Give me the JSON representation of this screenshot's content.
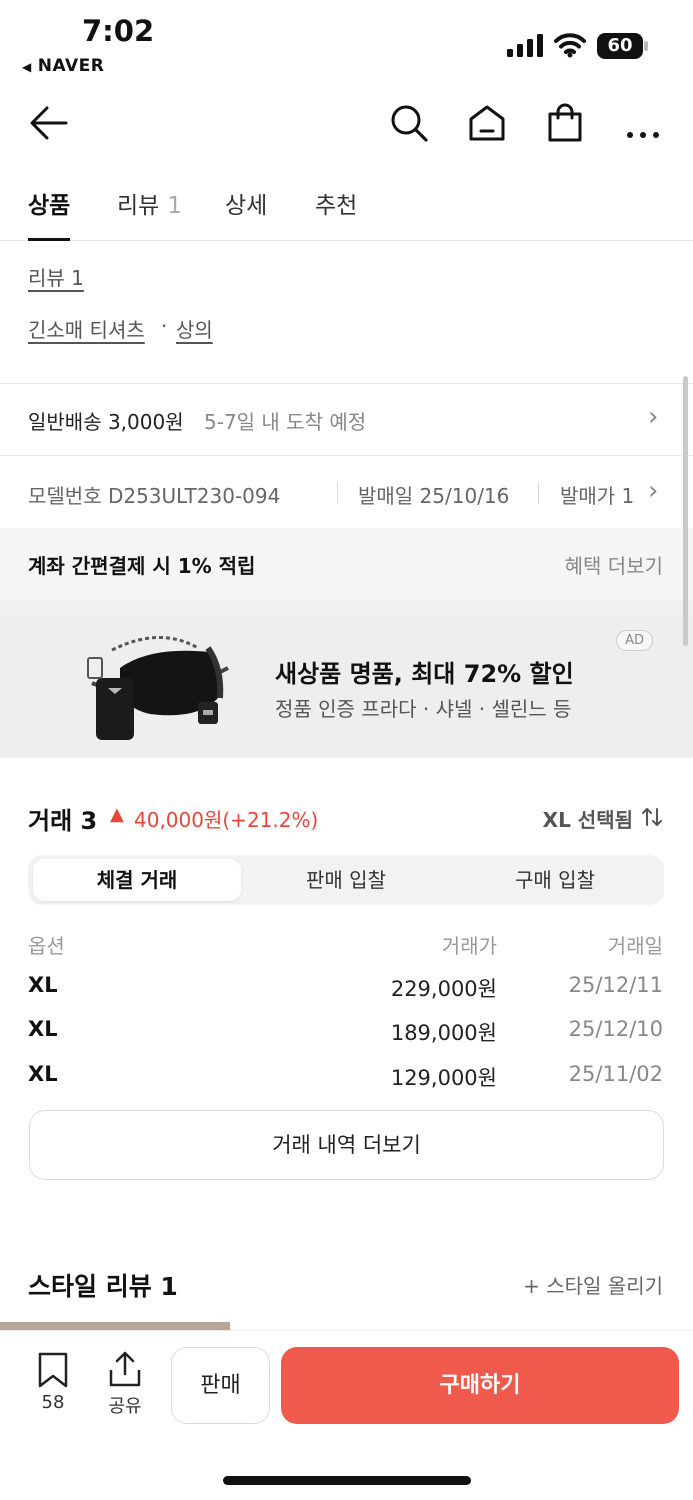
{
  "status": {
    "time": "7:02",
    "back_app": "NAVER",
    "battery": "60"
  },
  "nav": {
    "icons": [
      "back-arrow-icon",
      "search-icon",
      "home-icon",
      "shopping-bag-icon",
      "more-icon"
    ]
  },
  "tabs": [
    {
      "label": "상품",
      "count": ""
    },
    {
      "label": "리뷰",
      "count": "1"
    },
    {
      "label": "상세",
      "count": ""
    },
    {
      "label": "추천",
      "count": ""
    }
  ],
  "product": {
    "review_link": "리뷰 1",
    "category_1": "긴소매 티셔츠",
    "separator": "·",
    "category_2": "상의"
  },
  "shipping": {
    "label": "일반배송 3,000원",
    "eta": "5-7일 내 도착 예정"
  },
  "specs": {
    "model": "모델번호 D253ULT230-094",
    "release": "발매일 25/10/16",
    "price_partial": "발매가 1"
  },
  "benefit": {
    "text": "계좌 간편결제 시 1% 적립",
    "more": "혜택 더보기"
  },
  "ad": {
    "badge": "AD",
    "title": "새상품 명품, 최대 72% 할인",
    "subtitle": "정품 인증 프라다 · 샤넬 · 셀린느 등"
  },
  "trades": {
    "title": "거래 3",
    "change": "40,000원(+21.2%)",
    "change_color": "#e5483b",
    "selected": "XL 선택됨",
    "segments": [
      "체결 거래",
      "판매 입찰",
      "구매 입찰"
    ],
    "headers": {
      "option": "옵션",
      "price": "거래가",
      "date": "거래일"
    },
    "rows": [
      {
        "option": "XL",
        "price": "229,000원",
        "date": "25/12/11"
      },
      {
        "option": "XL",
        "price": "189,000원",
        "date": "25/12/10"
      },
      {
        "option": "XL",
        "price": "129,000원",
        "date": "25/11/02"
      }
    ],
    "more": "거래 내역 더보기"
  },
  "style": {
    "title": "스타일 리뷰 1",
    "upload": "+ 스타일 올리기"
  },
  "bottom": {
    "wish_count": "58",
    "share": "공유",
    "sell": "판매",
    "buy": "구매하기",
    "buy_color": "#ef5a4c"
  }
}
